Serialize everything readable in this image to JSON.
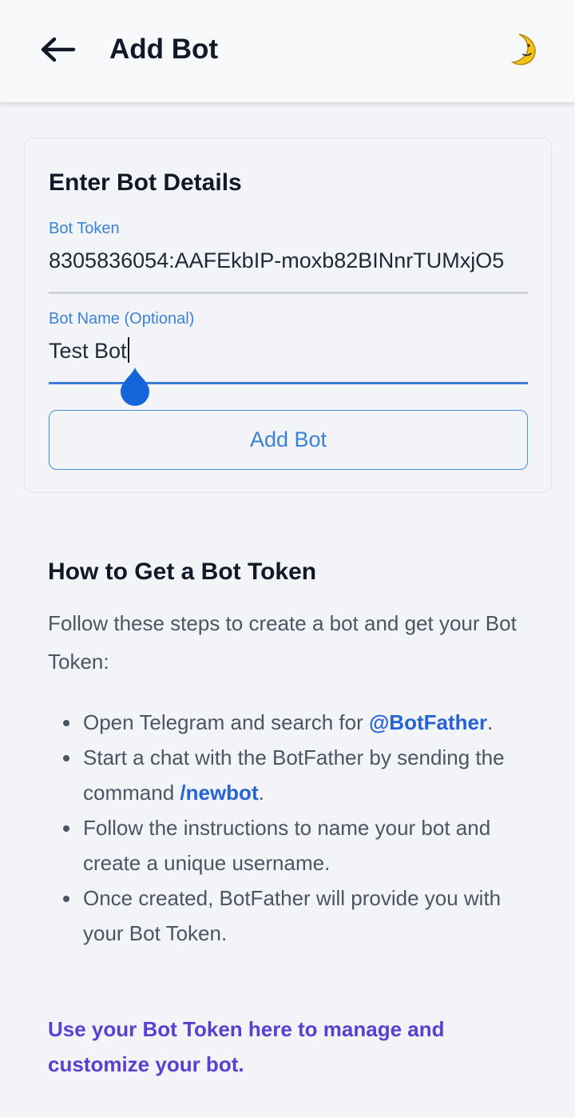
{
  "appbar": {
    "title": "Add Bot",
    "back_icon": "arrow-left-icon",
    "theme_icon": "crescent-moon-icon"
  },
  "form": {
    "title": "Enter Bot Details",
    "token_label": "Bot Token",
    "token_value": "8305836054:AAFEkbIP-moxb82BINnrTUMxjO5",
    "name_label": "Bot Name (Optional)",
    "name_value": "Test Bot",
    "submit_label": "Add Bot"
  },
  "help": {
    "title": "How to Get a Bot Token",
    "intro": "Follow these steps to create a bot and get your Bot Token:",
    "steps": [
      {
        "text": "Open Telegram and search for ",
        "link": "@BotFather",
        "after": "."
      },
      {
        "text": "Start a chat with the BotFather by sending the command ",
        "link": "/newbot",
        "after": "."
      },
      {
        "text": "Follow the instructions to name your bot and create a unique username."
      },
      {
        "text": "Once created, BotFather will provide you with your Bot Token."
      }
    ],
    "footer": "Use your Bot Token here to manage and customize your bot."
  },
  "colors": {
    "accent": "#3b82d6",
    "link": "#2563d6",
    "footer": "#5b3fd0",
    "background": "#f2f4f7"
  }
}
